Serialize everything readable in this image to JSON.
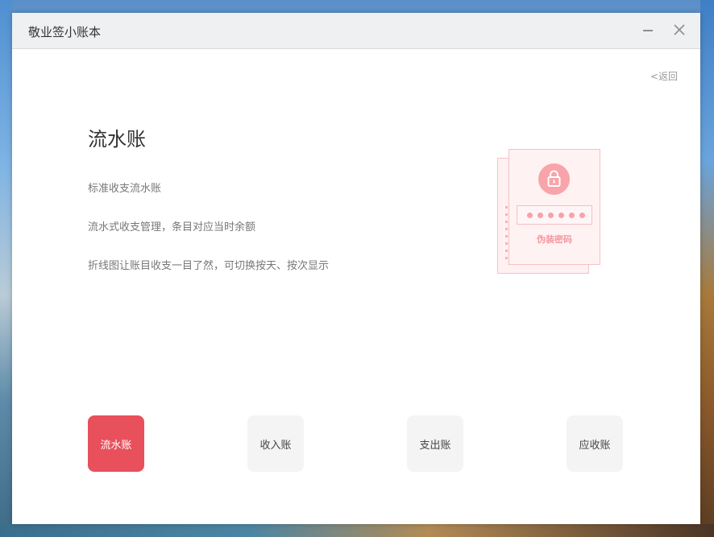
{
  "app": {
    "title": "敬业签小账本"
  },
  "nav": {
    "back_label": "<返回"
  },
  "content": {
    "title": "流水账",
    "features": [
      "标准收支流水账",
      "流水式收支管理，条目对应当时余额",
      "折线图让账目收支一目了然，可切换按天、按次显示"
    ]
  },
  "illustration": {
    "label": "伪装密码",
    "password_dots": 6,
    "icon": "lock-icon"
  },
  "tabs": [
    {
      "label": "流水账",
      "active": true
    },
    {
      "label": "收入账",
      "active": false
    },
    {
      "label": "支出账",
      "active": false
    },
    {
      "label": "应收账",
      "active": false
    }
  ],
  "colors": {
    "accent": "#e8505b",
    "illustration_pink": "#f8a4aa",
    "titlebar_bg": "#eef0f2"
  }
}
